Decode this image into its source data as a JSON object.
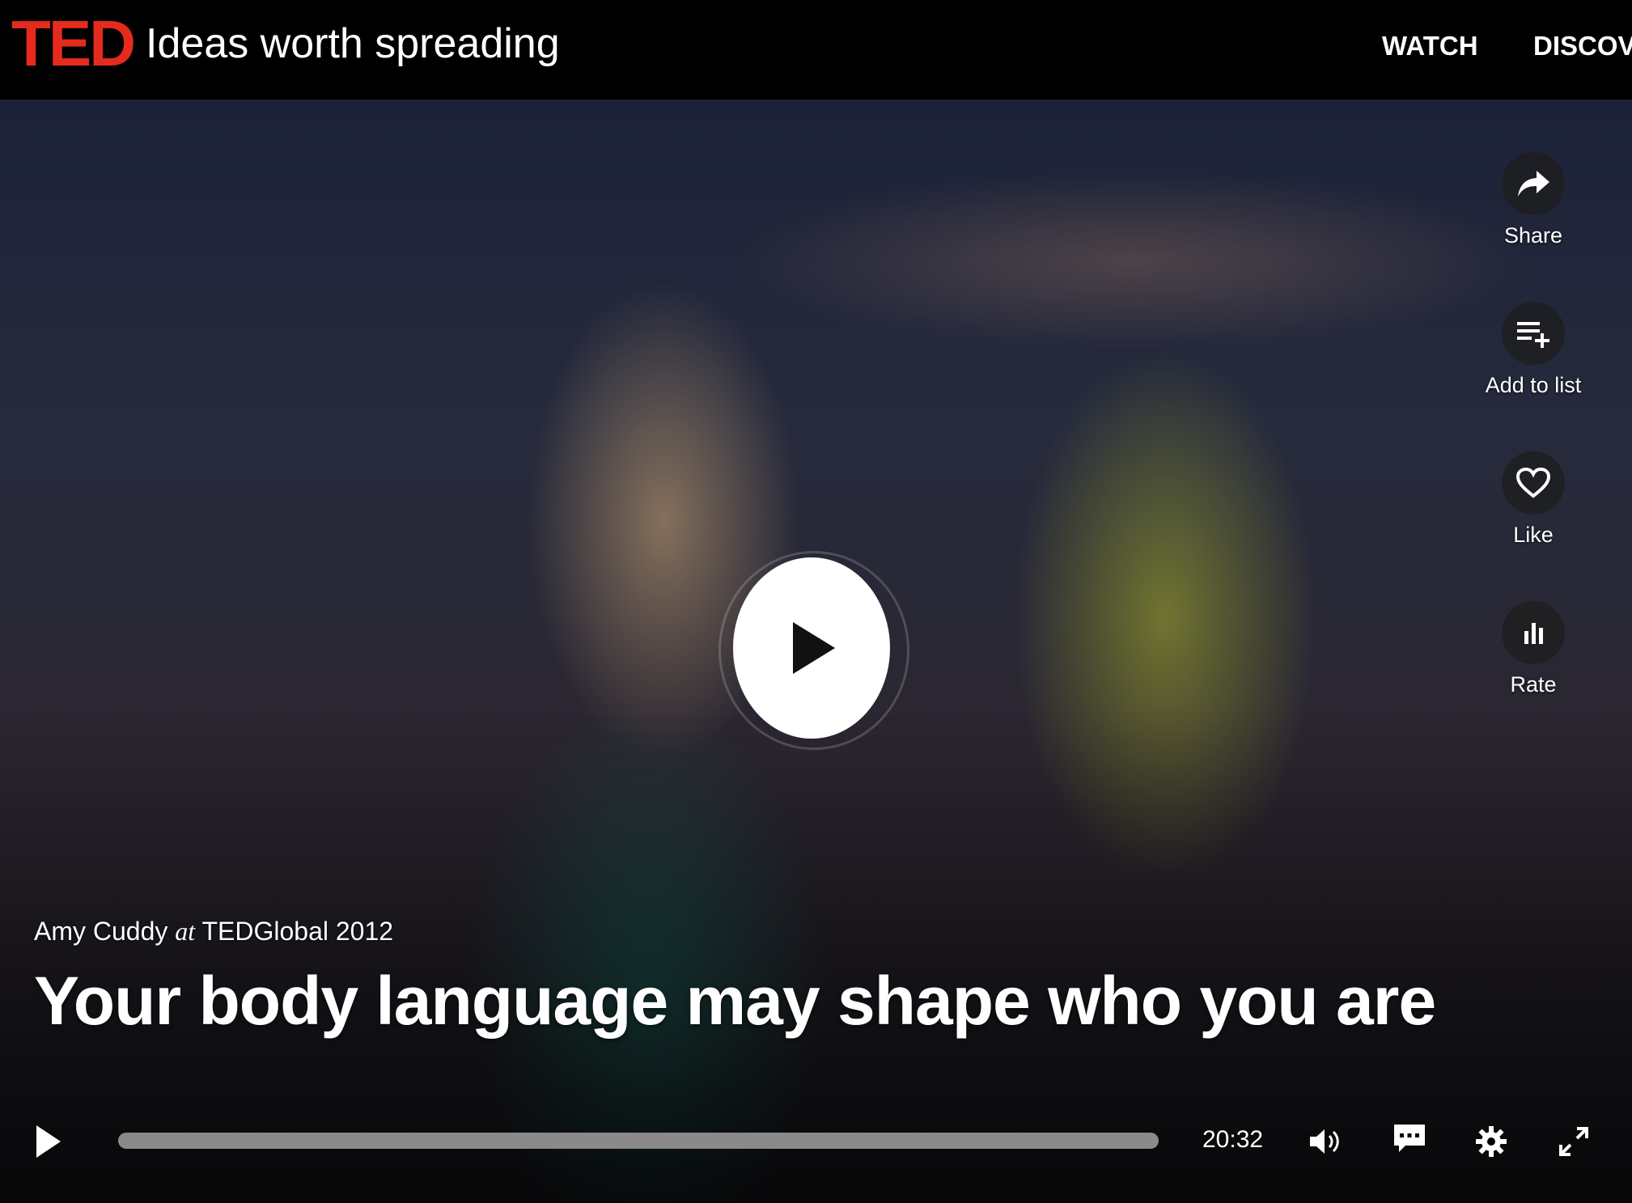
{
  "header": {
    "logo": "TED",
    "tagline": "Ideas worth spreading",
    "nav": {
      "watch": "WATCH",
      "discover": "DISCOVE"
    }
  },
  "actions": {
    "share": "Share",
    "add_to_list": "Add to list",
    "like": "Like",
    "rate": "Rate"
  },
  "talk": {
    "speaker": "Amy Cuddy",
    "at": "at",
    "event": "TEDGlobal 2012",
    "title": "Your body language may shape who you are"
  },
  "player": {
    "duration": "20:32",
    "progress": 0
  },
  "icons": [
    "share-icon",
    "add-to-list-icon",
    "heart-icon",
    "rate-icon",
    "play-icon",
    "volume-icon",
    "captions-icon",
    "settings-icon",
    "fullscreen-icon"
  ],
  "colors": {
    "brand": "#e62b1e",
    "background": "#000000"
  }
}
